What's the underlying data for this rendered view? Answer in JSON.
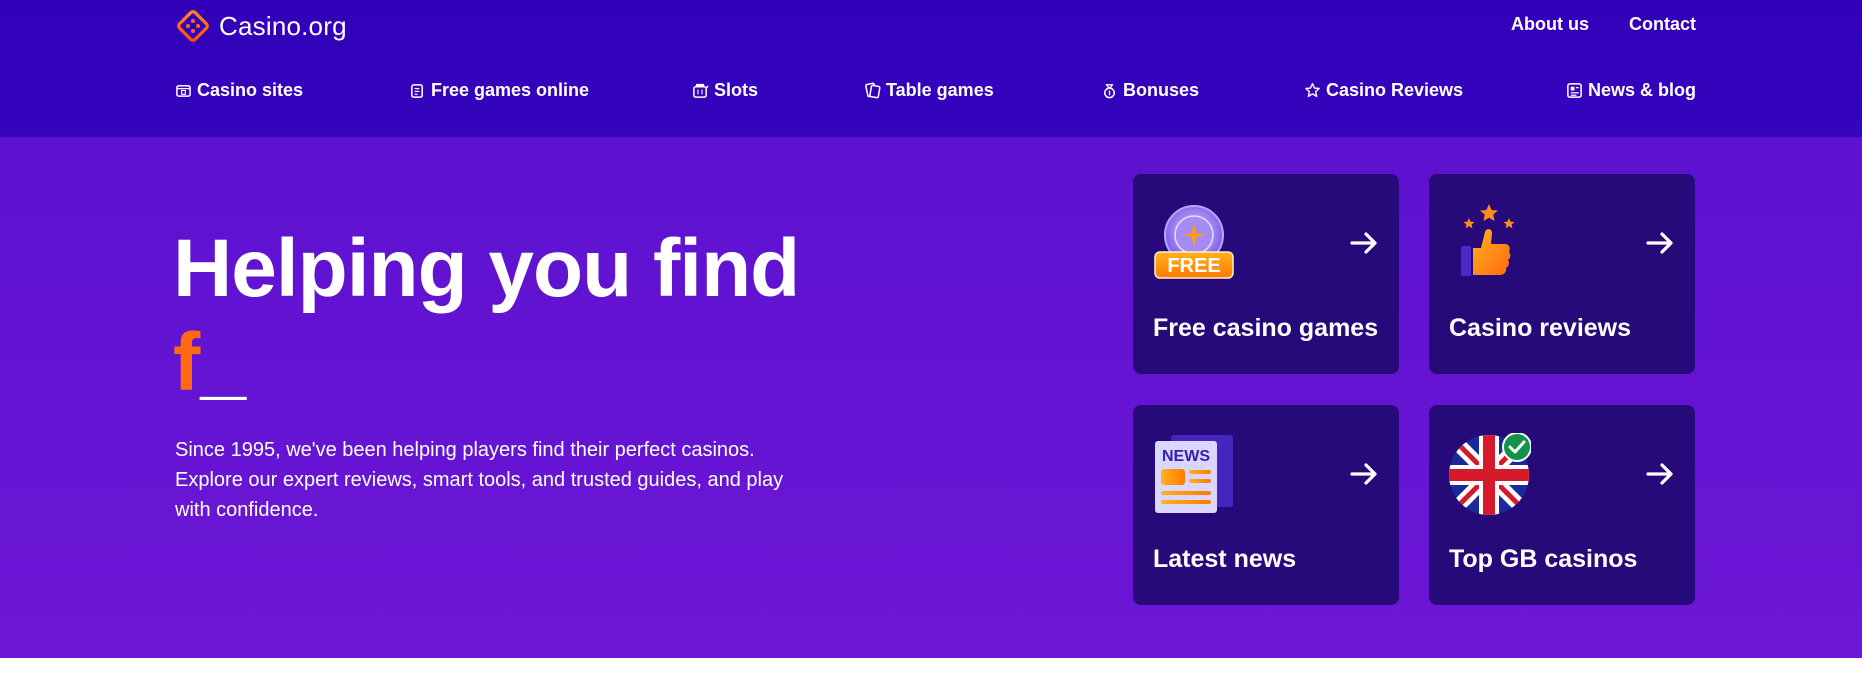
{
  "header": {
    "logo_text": "Casino.org",
    "top_links": [
      "About us",
      "Contact"
    ]
  },
  "nav": {
    "items": [
      {
        "label": "Casino sites",
        "icon": "casino-sites-icon"
      },
      {
        "label": "Free games online",
        "icon": "free-games-icon"
      },
      {
        "label": "Slots",
        "icon": "slots-icon"
      },
      {
        "label": "Table games",
        "icon": "table-games-icon"
      },
      {
        "label": "Bonuses",
        "icon": "bonuses-icon"
      },
      {
        "label": "Casino Reviews",
        "icon": "star-icon"
      },
      {
        "label": "News & blog",
        "icon": "news-icon"
      }
    ]
  },
  "hero": {
    "title": "Helping you find",
    "typed_text": "f",
    "cursor": "_",
    "description": "Since 1995, we've been helping players find their perfect casinos. Explore our expert reviews, smart tools, and trusted guides, and play with confidence."
  },
  "cards": [
    {
      "label": "Free casino games",
      "icon": "free-chip-icon"
    },
    {
      "label": "Casino reviews",
      "icon": "thumbs-up-stars-icon"
    },
    {
      "label": "Latest news",
      "icon": "newspaper-icon",
      "icon_text": "NEWS"
    },
    {
      "label": "Top GB casinos",
      "icon": "uk-flag-check-icon"
    }
  ],
  "icons": {
    "free_chip_text": "FREE"
  },
  "colors": {
    "header_bg": "#3100b8",
    "hero_bg": "#6412d3",
    "card_bg": "#260a7a",
    "accent_orange": "#ff6a13"
  }
}
